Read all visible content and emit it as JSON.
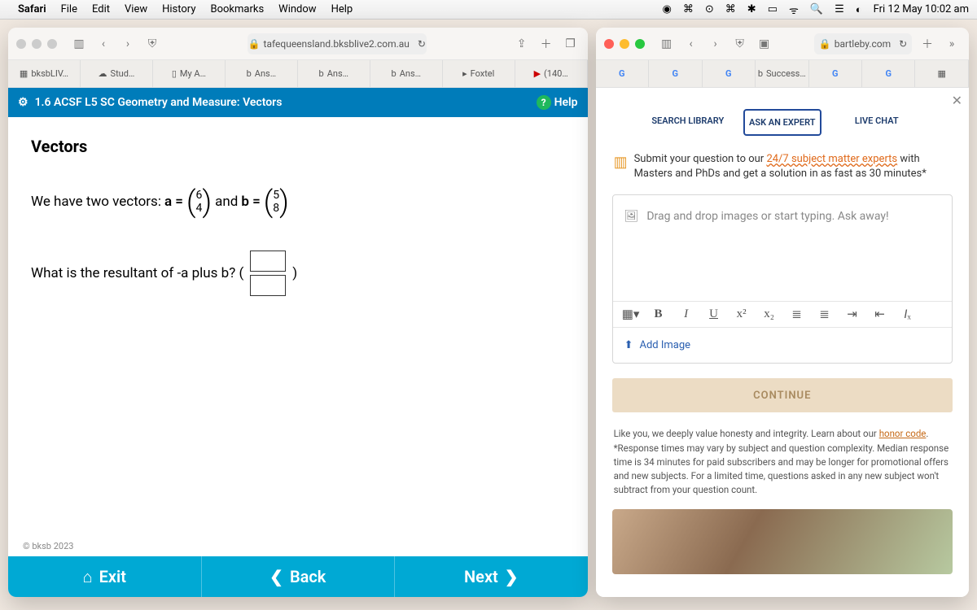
{
  "menubar": {
    "app": "Safari",
    "items": [
      "File",
      "Edit",
      "View",
      "History",
      "Bookmarks",
      "Window",
      "Help"
    ],
    "clock": "Fri 12 May  10:02 am"
  },
  "win1": {
    "address": "tafequeensland.bksblive2.com.au",
    "tabs": [
      "bksbLIV…",
      "Stud…",
      "My A…",
      "Ans…",
      "Ans…",
      "Ans…",
      "Foxtel",
      "(140…"
    ],
    "title": "1.6 ACSF L5 SC Geometry and Measure: Vectors",
    "help": "Help",
    "h2": "Vectors",
    "line1_a": "We have two vectors:",
    "line1_b": "a =",
    "vecA_top": "6",
    "vecA_bot": "4",
    "line1_c": "and",
    "line1_d": "b =",
    "vecB_top": "5",
    "vecB_bot": "8",
    "q2": "What is the resultant of -a plus b?   (",
    "q2_close": ")",
    "copyright": "© bksb 2023",
    "exit": "Exit",
    "back": "Back",
    "next": "Next"
  },
  "win2": {
    "address": "bartleby.com",
    "tabs_g": "G",
    "tab_success": "Success…",
    "btabs": {
      "search": "SEARCH LIBRARY",
      "ask": "ASK AN EXPERT",
      "chat": "LIVE CHAT"
    },
    "submit_a": "Submit your question to our ",
    "submit_b": "24/7 subject matter experts",
    "submit_c": " with Masters and PhDs and get a solution in as fast as 30 minutes*",
    "placeholder": "Drag and drop images or start typing. Ask away!",
    "addimg": "Add Image",
    "continue": "CONTINUE",
    "fine_a": "Like you, we deeply value honesty and integrity. Learn about our ",
    "fine_link": "honor code",
    "fine_b": ".",
    "fine_c": "*Response times may vary by subject and question complexity. Median response time is 34 minutes for paid subscribers and may be longer for promotional offers and new subjects. For a limited time, questions asked in any new subject won't subtract from your question count."
  }
}
